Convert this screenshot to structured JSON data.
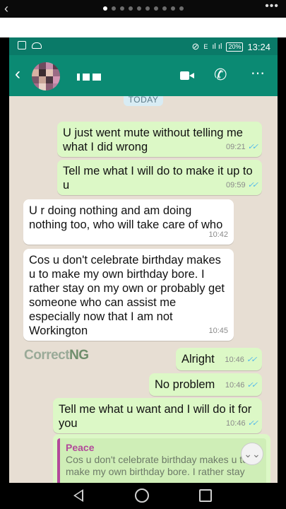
{
  "viewer": {
    "back_icon": "‹",
    "more_icon": "•••",
    "page_dots": 10,
    "active_dot": 0
  },
  "status_bar": {
    "network": "E",
    "battery": "20%",
    "time": "13:24"
  },
  "header": {
    "back_icon": "back-arrow-icon",
    "contact_name": "",
    "video_icon": "video-call-icon",
    "call_icon": "phone-call-icon",
    "menu_icon": "more-vert-icon"
  },
  "chat": {
    "date_chip": "TODAY",
    "messages": [
      {
        "direction": "outgoing",
        "text": "U just went mute without telling me what I did wrong",
        "time": "09:21",
        "ticks": "✓✓"
      },
      {
        "direction": "outgoing",
        "text": "Tell me what I will do to make it up to u",
        "time": "09:59",
        "ticks": "✓✓"
      },
      {
        "direction": "incoming",
        "text": "U r doing nothing and am doing nothing too, who will take care of who",
        "time": "10:42"
      },
      {
        "direction": "incoming",
        "text": "Cos u don't celebrate birthday makes u to make my own birthday bore. I rather stay on my own or probably get someone who can assist me especially now that I am not Workington",
        "time": "10:45"
      },
      {
        "direction": "outgoing",
        "text": "Alright",
        "time": "10:46",
        "ticks": "✓✓"
      },
      {
        "direction": "outgoing",
        "text": "No problem",
        "time": "10:46",
        "ticks": "✓✓"
      },
      {
        "direction": "outgoing",
        "text": "Tell me what u want and I will do it for you",
        "time": "10:46",
        "ticks": "✓✓"
      }
    ],
    "quoted_reply": {
      "author": "Peace",
      "text": "Cos u don't celebrate birthday makes u to make my own birthday bore. I rather stay"
    },
    "watermark": {
      "part1": "Correct",
      "part2": "NG"
    },
    "scroll_down_icon": "double-chevron-down-icon"
  },
  "nav": {
    "back": "nav-back-icon",
    "home": "nav-home-icon",
    "recents": "nav-recents-icon"
  }
}
